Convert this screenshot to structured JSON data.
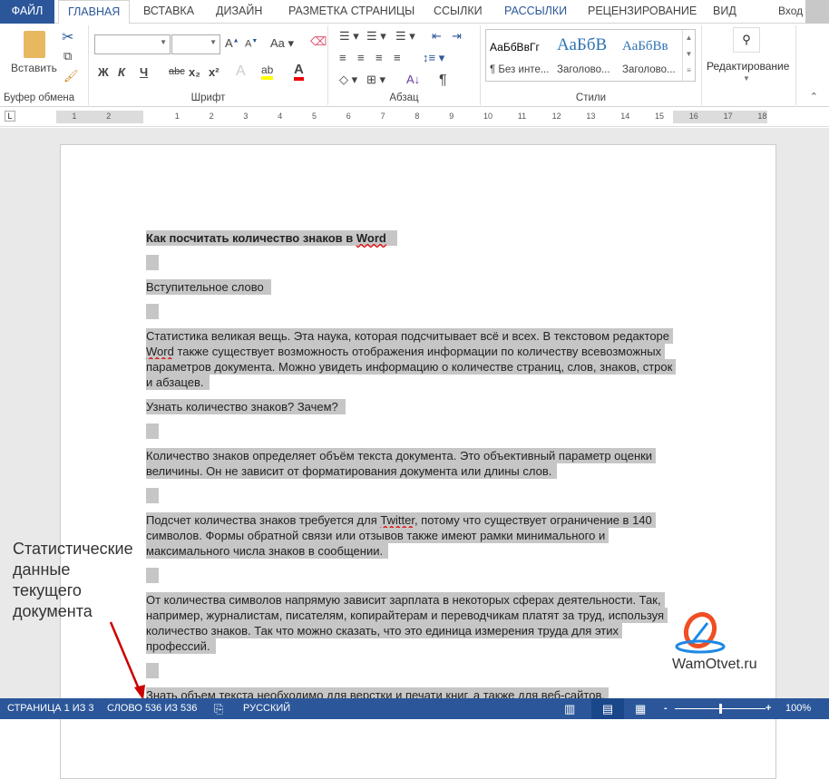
{
  "tabs": [
    "ФАЙЛ",
    "ГЛАВНАЯ",
    "ВСТАВКА",
    "ДИЗАЙН",
    "РАЗМЕТКА СТРАНИЦЫ",
    "ССЫЛКИ",
    "РАССЫЛКИ",
    "РЕЦЕНЗИРОВАНИЕ",
    "ВИД"
  ],
  "signin": "Вход",
  "ribbon": {
    "paste": "Вставить",
    "clipboard": "Буфер обмена",
    "font": "Шрифт",
    "paragraph": "Абзац",
    "styles": "Стили",
    "editing": "Редактирование",
    "font_buttons": [
      "Ж",
      "К",
      "Ч",
      "abc",
      "x₂",
      "x²"
    ],
    "style_items": [
      {
        "preview": "АаБбВвГг",
        "name": "¶ Без инте..."
      },
      {
        "preview": "АаБбВ",
        "name": "Заголово..."
      },
      {
        "preview": "АаБбВв",
        "name": "Заголово..."
      }
    ]
  },
  "ruler": {
    "left": [
      "2",
      "1"
    ],
    "right": [
      "1",
      "2",
      "3",
      "4",
      "5",
      "6",
      "7",
      "8",
      "9",
      "10",
      "11",
      "12",
      "13",
      "14",
      "15",
      "16",
      "17",
      "18"
    ]
  },
  "doc": {
    "title_a": "Как посчитать количество знаков в ",
    "title_b": "Word",
    "intro": "Вступительное слово",
    "p1": [
      "Статистика великая вещь. Эта наука, которая подсчитывает всё и всех. В текстовом редакторе",
      "также существует возможность отображения информации по количеству всевозможных",
      "параметров документа. Можно увидеть информацию о количестве страниц, слов, знаков, строк",
      "и абзацев."
    ],
    "p1_word": "Word",
    "h2": "Узнать количество знаков? Зачем?",
    "p2": [
      "Количество знаков определяет объём текста документа. Это объективный параметр оценки",
      "величины. Он не зависит от форматирования документа или длины слов."
    ],
    "p3a": "Подсчет количества знаков требуется для ",
    "p3tw": "Twitter",
    "p3b": ", потому что существует ограничение в 140",
    "p3": [
      "символов. Формы обратной связи или отзывов также имеют рамки минимального и",
      "максимального числа знаков в сообщении."
    ],
    "p4": [
      "От количества символов напрямую зависит зарплата в некоторых сферах деятельности. Так,",
      "например, журналистам, писателям, копирайтерам и переводчикам платят за труд, используя",
      "количество знаков. Так что можно сказать, что это единица измерения труда для этих",
      "профессий."
    ],
    "p5": "Знать объем текста необходимо для верстки и печати книг, а также для веб-сайтов."
  },
  "annotation": [
    "Статистические",
    "данные",
    "текущего",
    "документа"
  ],
  "watermark": "WamOtvet.ru",
  "status": {
    "page": "СТРАНИЦА 1 ИЗ 3",
    "words": "СЛОВО 536 ИЗ 536",
    "lang": "РУССКИЙ",
    "zoom": "100%",
    "zoom_fraction": 0.5
  },
  "colors": {
    "accent": "#2b579a",
    "highlight": "#c6c6c6"
  }
}
